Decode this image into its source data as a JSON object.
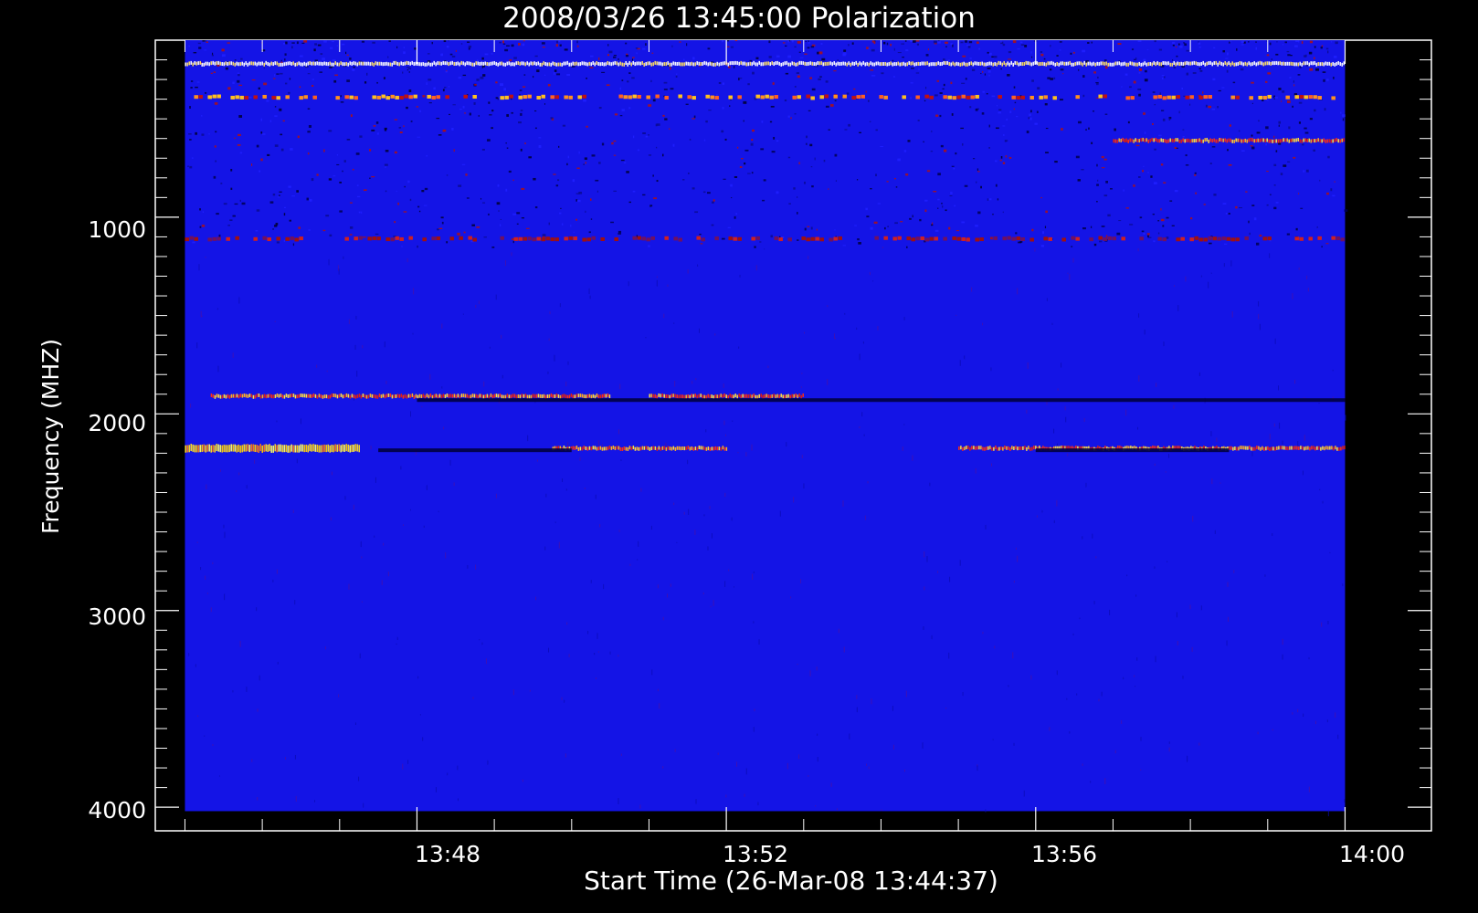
{
  "chart_data": {
    "type": "heatmap",
    "title": "2008/03/26 13:45:00 Polarization",
    "xlabel": "Start Time (26-Mar-08 13:44:37)",
    "ylabel": "Frequency (MHZ)",
    "x_ticks": [
      "13:48",
      "13:52",
      "13:56",
      "14:00"
    ],
    "y_ticks": [
      "1000",
      "2000",
      "3000",
      "4000"
    ],
    "y_tick_values": [
      1000,
      2000,
      3000,
      4000
    ],
    "ylim": [
      100,
      4120
    ],
    "y_inverted": true,
    "data_ylim": [
      100,
      4020
    ],
    "xlim": [
      "13:44:37",
      "14:01:07"
    ],
    "data_xlim": [
      "13:45:00",
      "14:00:00"
    ],
    "background_color": "#1414e6",
    "colormap": [
      "#000040",
      "#1414e6",
      "#b01010",
      "#ff4020",
      "#ffd020",
      "#ffffff"
    ],
    "features": [
      {
        "freq_mhz": 220,
        "spans": [
          [
            "13:45:00",
            "14:00:00"
          ]
        ],
        "intensity": "white"
      },
      {
        "freq_mhz": 390,
        "spans": [
          [
            "13:45:00",
            "14:00:00"
          ]
        ],
        "intensity": "orange-speckle"
      },
      {
        "freq_mhz": 610,
        "spans": [
          [
            "13:57:00",
            "14:00:00"
          ]
        ],
        "intensity": "orange"
      },
      {
        "freq_mhz": 1110,
        "spans": [
          [
            "13:45:00",
            "14:00:00"
          ]
        ],
        "intensity": "red-speckle"
      },
      {
        "freq_mhz": 1910,
        "spans": [
          [
            "13:45:20",
            "13:50:30"
          ],
          [
            "13:51:00",
            "13:53:00"
          ]
        ],
        "intensity": "orange"
      },
      {
        "freq_mhz": 1930,
        "spans": [
          [
            "13:48:00",
            "14:00:00"
          ]
        ],
        "intensity": "dark"
      },
      {
        "freq_mhz": 2175,
        "spans": [
          [
            "13:45:00",
            "13:47:15"
          ]
        ],
        "intensity": "yellow"
      },
      {
        "freq_mhz": 2175,
        "spans": [
          [
            "13:49:45",
            "13:52:00"
          ],
          [
            "13:55:00",
            "14:00:00"
          ]
        ],
        "intensity": "orange"
      },
      {
        "freq_mhz": 2185,
        "spans": [
          [
            "13:47:30",
            "13:50:00"
          ],
          [
            "13:56:00",
            "13:58:30"
          ]
        ],
        "intensity": "dark"
      }
    ]
  }
}
